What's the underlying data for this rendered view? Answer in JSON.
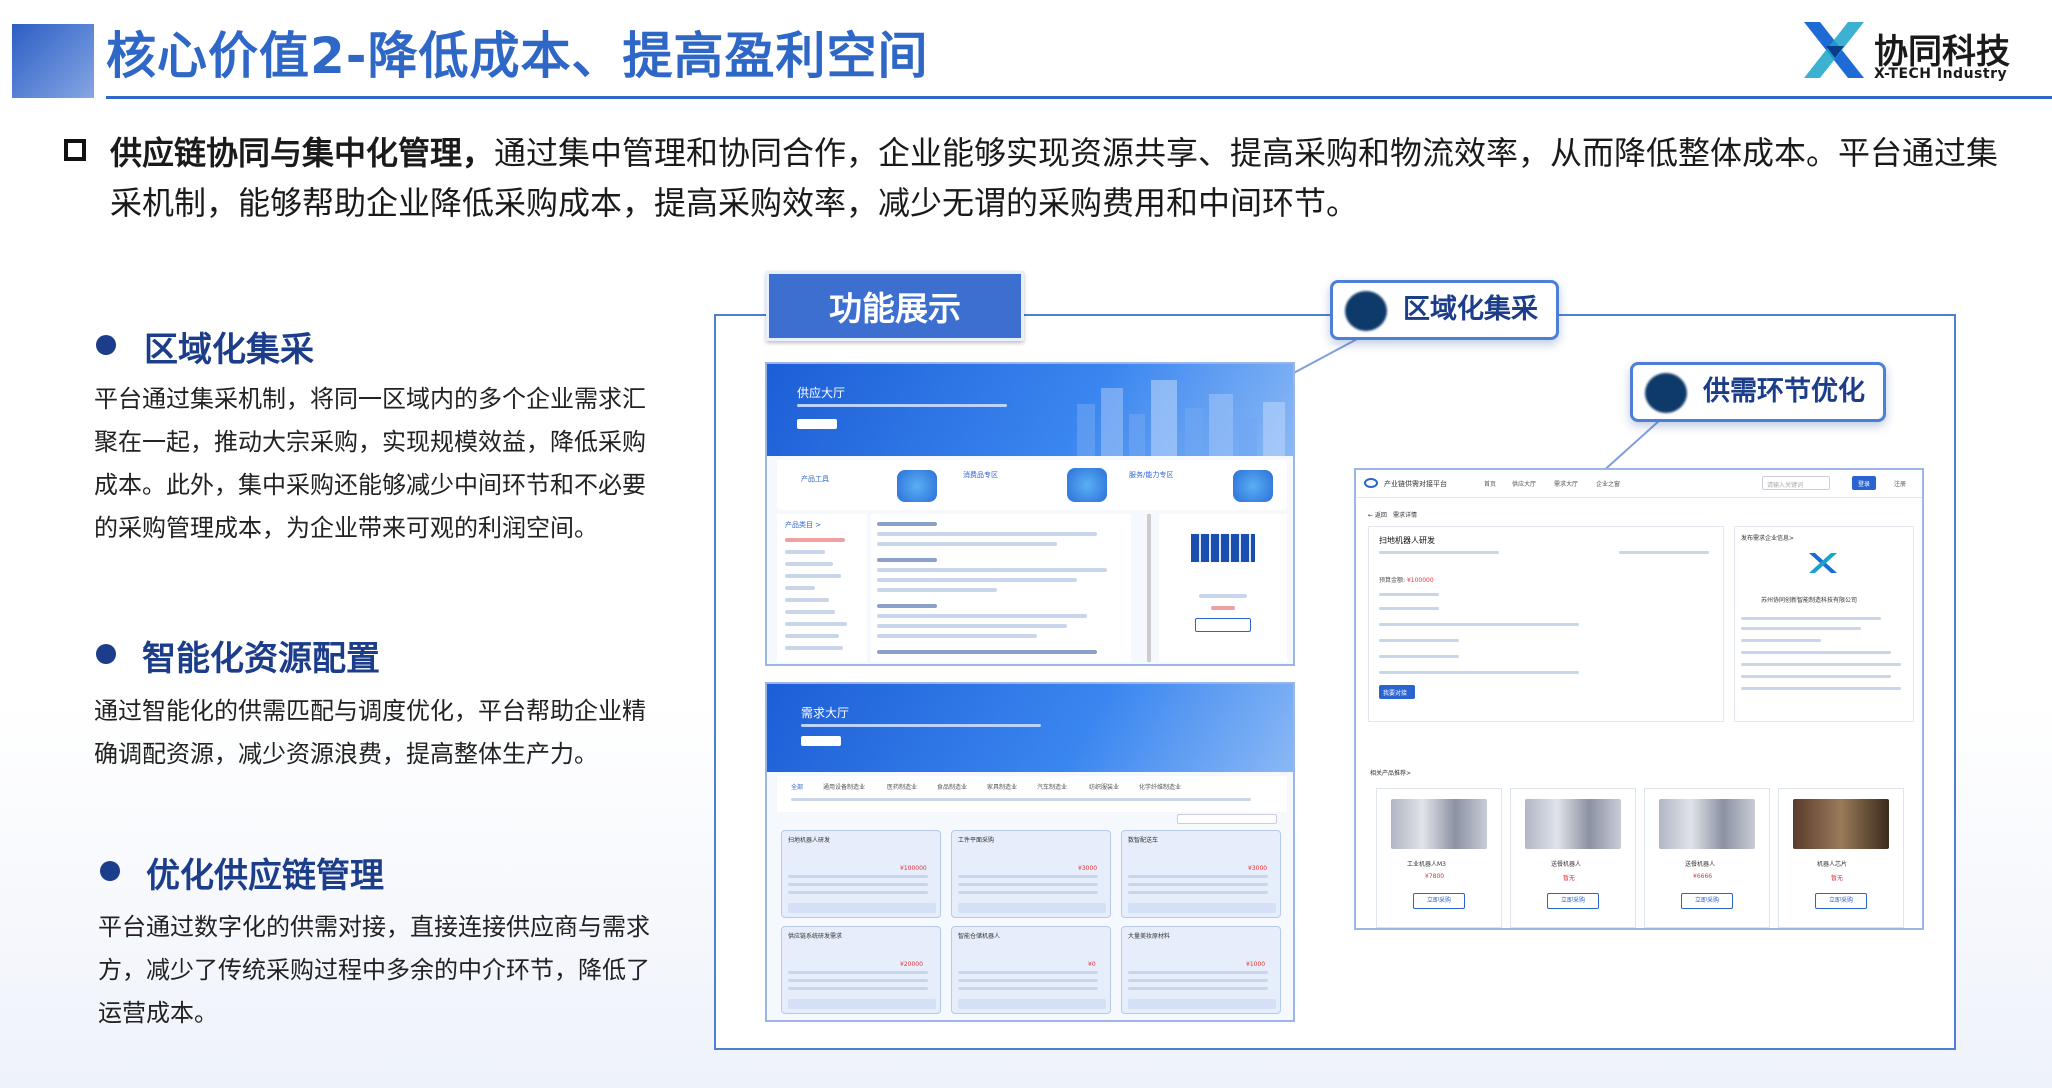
{
  "header": {
    "title": "核心价值2-降低成本、提高盈利空间"
  },
  "logo": {
    "cn": "协同科技",
    "en": "X-TECH Industry"
  },
  "intro": {
    "bold": "供应链协同与集中化管理，",
    "text": "通过集中管理和协同合作，企业能够实现资源共享、提高采购和物流效率，从而降低整体成本。平台通过集采机制，能够帮助企业降低采购成本，提高采购效率，减少无谓的采购费用和中间环节。"
  },
  "sections": [
    {
      "title": "区域化集采",
      "body": "平台通过集采机制，将同一区域内的多个企业需求汇聚在一起，推动大宗采购，实现规模效益，降低采购成本。此外，集中采购还能够减少中间环节和不必要的采购管理成本，为企业带来可观的利润空间。"
    },
    {
      "title": "智能化资源配置",
      "body": "通过智能化的供需匹配与调度优化，平台帮助企业精确调配资源，减少资源浪费，提高整体生产力。"
    },
    {
      "title": "优化供应链管理",
      "body": "平台通过数字化的供需对接，直接连接供应商与需求方，减少了传统采购过程中多余的中介环节，降低了运营成本。"
    }
  ],
  "panel": {
    "tag": "功能展示",
    "callouts": [
      "区域化集采",
      "供需环节优化"
    ]
  },
  "shot1": {
    "banner_title": "供应大厅",
    "cats": [
      "产品工具",
      "消费品专区",
      "服务/能力专区"
    ],
    "sidebar_title": "产品类目 >"
  },
  "shot2": {
    "banner_title": "需求大厅",
    "tabs": [
      "全部",
      "通用设备制造业",
      "医药制造业",
      "食品制造业",
      "家具制造业",
      "汽车制造业",
      "纺织服装业",
      "化学纤维制造业"
    ],
    "cards": [
      {
        "title": "扫地机器人研发",
        "price": "¥100000"
      },
      {
        "title": "工件平面采购",
        "price": "¥3000"
      },
      {
        "title": "数智配送车",
        "price": "¥3000"
      },
      {
        "title": "供应链系统研发需求",
        "price": "¥20000"
      },
      {
        "title": "智能仓储机器人",
        "price": "¥0"
      },
      {
        "title": "大量美妆原材料",
        "price": "¥1000"
      }
    ]
  },
  "shot3": {
    "brand": "产业链供需对接平台",
    "nav": [
      "首页",
      "供应大厅",
      "需求大厅",
      "企业之窗"
    ],
    "search_placeholder": "请输入关键词",
    "login": "登录",
    "register": "注册",
    "crumb": "需求详情",
    "demand_title": "扫地机器人研发",
    "budget": "¥100000",
    "publisher_title": "发布需求企业信息>",
    "company": "苏州协同创新智能制造科技有限公司",
    "related": "相关产品推荐>",
    "products": [
      {
        "name": "工业机器人M3",
        "price": "¥7800"
      },
      {
        "name": "送餐机器人",
        "price": "暂无"
      },
      {
        "name": "送餐机器人",
        "price": "¥6666"
      },
      {
        "name": "机器人芯片",
        "price": "暂无"
      }
    ],
    "buy": "立即采购",
    "contact": "我要对接"
  }
}
